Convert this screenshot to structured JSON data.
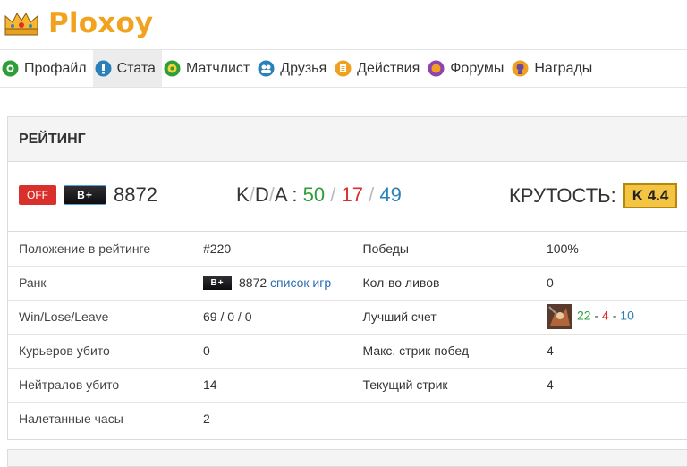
{
  "site": {
    "name": "Ploxoy"
  },
  "nav": [
    {
      "label": "Профайл",
      "icon": "profile-icon",
      "color": "#2e9e39"
    },
    {
      "label": "Стата",
      "icon": "stats-icon",
      "color": "#2a80b9"
    },
    {
      "label": "Матчлист",
      "icon": "matchlist-icon",
      "color": "#2e9e39"
    },
    {
      "label": "Друзья",
      "icon": "friends-icon",
      "color": "#2a80b9"
    },
    {
      "label": "Действия",
      "icon": "actions-icon",
      "color": "#f0a020"
    },
    {
      "label": "Форумы",
      "icon": "forums-icon",
      "color": "#8e44ad"
    },
    {
      "label": "Награды",
      "icon": "awards-icon",
      "color": "#f0a020"
    }
  ],
  "rating": {
    "title": "РЕЙТИНГ",
    "status_badge": "OFF",
    "rank_badge": "B+",
    "rating_value": "8872",
    "kda_label_k": "K",
    "kda_label_d": "D",
    "kda_label_a": "A",
    "kills": "50",
    "deaths": "17",
    "assists": "49",
    "krutost_label": "КРУТОСТЬ:",
    "krutost_value": "K 4.4"
  },
  "stats": {
    "pos_label": "Положение в рейтинге",
    "pos_value": "#220",
    "wins_label": "Победы",
    "wins_value": "100%",
    "rank_label": "Ранк",
    "rank_badge": "B+",
    "rank_value": "8872",
    "rank_link": "список игр",
    "leaves_label": "Кол-во ливов",
    "leaves_value": "0",
    "wll_label": "Win/Lose/Leave",
    "wll_value": "69 / 0 / 0",
    "best_label": "Лучший счет",
    "best_k": "22",
    "best_d": "4",
    "best_a": "10",
    "couriers_label": "Курьеров убито",
    "couriers_value": "0",
    "streak_max_label": "Макс. стрик побед",
    "streak_max_value": "4",
    "neutrals_label": "Нейтралов убито",
    "neutrals_value": "14",
    "streak_cur_label": "Текущий стрик",
    "streak_cur_value": "4",
    "hours_label": "Налетанные часы",
    "hours_value": "2"
  }
}
